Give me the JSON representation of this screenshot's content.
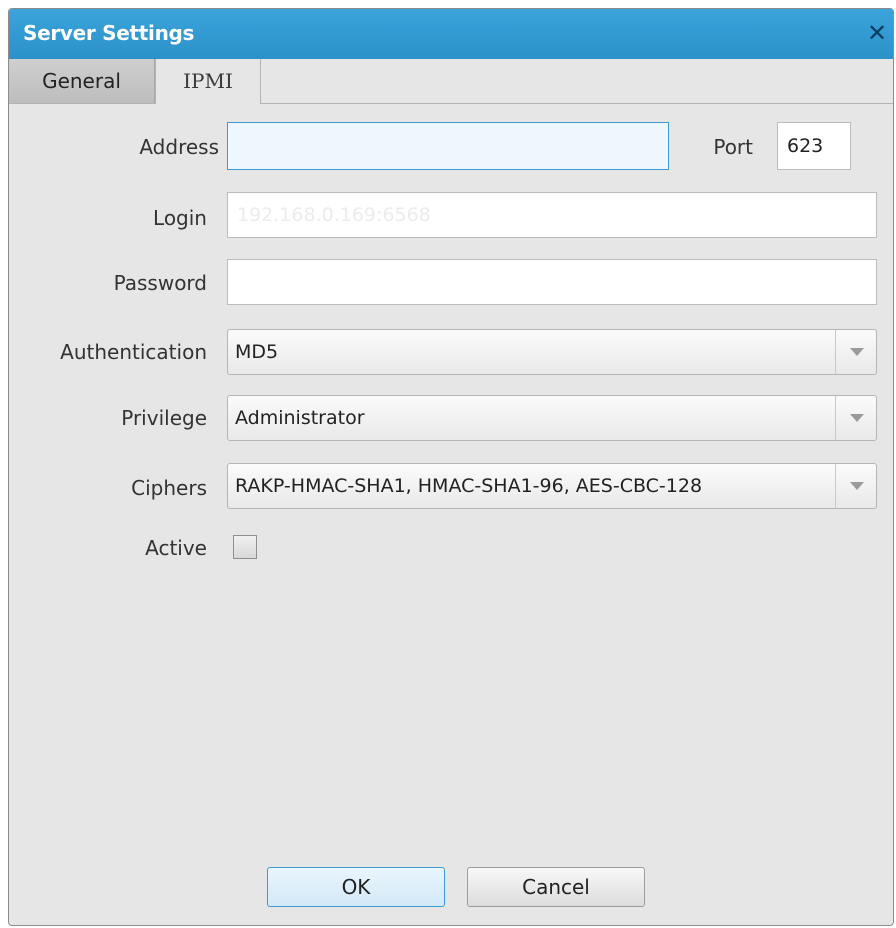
{
  "window": {
    "title": "Server Settings"
  },
  "tabs": [
    {
      "label": "General",
      "selected": false
    },
    {
      "label": "IPMI",
      "selected": true
    }
  ],
  "form": {
    "address": {
      "label": "Address",
      "value": "",
      "placeholder": ""
    },
    "port": {
      "label": "Port",
      "value": "623"
    },
    "login": {
      "label": "Login",
      "value": "",
      "placeholder": "192.168.0.169:6568"
    },
    "password": {
      "label": "Password",
      "value": ""
    },
    "authentication": {
      "label": "Authentication",
      "selected": "MD5"
    },
    "privilege": {
      "label": "Privilege",
      "selected": "Administrator"
    },
    "ciphers": {
      "label": "Ciphers",
      "selected": "RAKP-HMAC-SHA1, HMAC-SHA1-96, AES-CBC-128"
    },
    "active": {
      "label": "Active",
      "checked": false
    }
  },
  "buttons": {
    "ok": "OK",
    "cancel": "Cancel"
  },
  "icons": {
    "close": "close-icon",
    "dropdown_arrow": "chevron-down-icon"
  },
  "colors": {
    "title_bar": "#2b91c9",
    "focus_border": "#3c9bd3",
    "dialog_bg": "#e6e6e6"
  }
}
